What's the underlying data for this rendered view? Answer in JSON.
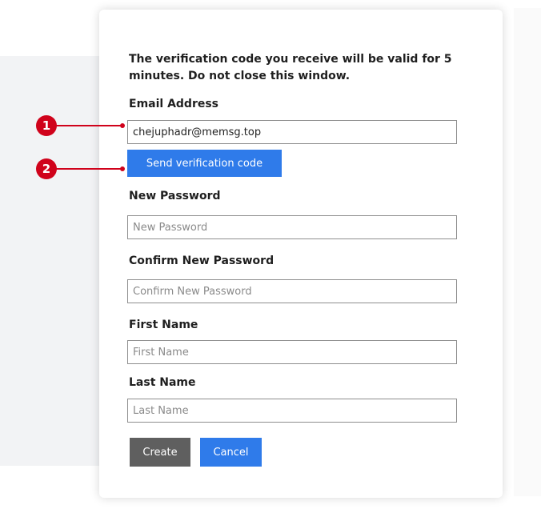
{
  "form": {
    "intro": "The verification code you receive will be valid for 5 minutes. Do not close this window.",
    "email_label": "Email Address",
    "email_value": "chejuphadr@memsg.top",
    "send_code_label": "Send verification code",
    "new_password_label": "New Password",
    "new_password_placeholder": "New Password",
    "confirm_password_label": "Confirm New Password",
    "confirm_password_placeholder": "Confirm New Password",
    "first_name_label": "First Name",
    "first_name_placeholder": "First Name",
    "last_name_label": "Last Name",
    "last_name_placeholder": "Last Name",
    "create_label": "Create",
    "cancel_label": "Cancel"
  },
  "callouts": [
    {
      "number": "1"
    },
    {
      "number": "2"
    }
  ],
  "colors": {
    "primary": "#2f7bea",
    "secondary": "#5f5f5f",
    "callout": "#d0021b"
  }
}
